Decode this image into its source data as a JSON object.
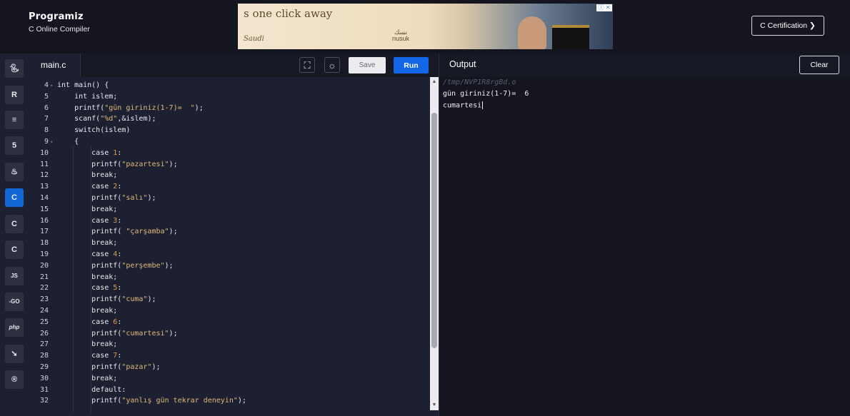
{
  "header": {
    "brand": "Programiz",
    "subtitle": "C Online Compiler",
    "certification_label": "C Certification ❯",
    "ad": {
      "headline": "s one click away",
      "signature": "Saudi",
      "brand_arabic": "نسك",
      "brand_latin": "nusuk",
      "info_badge": "ⓘ ✕"
    }
  },
  "sidebar": {
    "languages": [
      {
        "name": "python",
        "glyph": "🐍︎"
      },
      {
        "name": "r",
        "glyph": "R"
      },
      {
        "name": "sql",
        "glyph": "≡"
      },
      {
        "name": "html",
        "glyph": "5"
      },
      {
        "name": "java",
        "glyph": "♨"
      },
      {
        "name": "c",
        "glyph": "C"
      },
      {
        "name": "cpp",
        "glyph": "C"
      },
      {
        "name": "csharp",
        "glyph": "C"
      },
      {
        "name": "javascript",
        "glyph": "JS"
      },
      {
        "name": "go",
        "glyph": "-GO"
      },
      {
        "name": "php",
        "glyph": "php"
      },
      {
        "name": "swift",
        "glyph": "➘"
      },
      {
        "name": "rust",
        "glyph": "®"
      }
    ],
    "active": "c"
  },
  "editor": {
    "tab_label": "main.c",
    "fullscreen_icon": "fullscreen-icon",
    "theme_icon": "sun-icon",
    "save_label": "Save",
    "run_label": "Run",
    "lines": [
      {
        "n": "4",
        "text": "int main() {"
      },
      {
        "n": "5",
        "text": "    int islem;"
      },
      {
        "n": "6",
        "text": "    printf(\"gün giriniz(1-7)=  \");"
      },
      {
        "n": "7",
        "text": "    scanf(\"%d\",&islem);"
      },
      {
        "n": "8",
        "text": "    switch(islem)"
      },
      {
        "n": "9",
        "text": "    {"
      },
      {
        "n": "10",
        "text": "        case 1:"
      },
      {
        "n": "11",
        "text": "        printf(\"pazartesi\");"
      },
      {
        "n": "12",
        "text": "        break;"
      },
      {
        "n": "13",
        "text": "        case 2:"
      },
      {
        "n": "14",
        "text": "        printf(\"salı\");"
      },
      {
        "n": "15",
        "text": "        break;"
      },
      {
        "n": "16",
        "text": "        case 3:"
      },
      {
        "n": "17",
        "text": "        printf( \"çarşamba\");"
      },
      {
        "n": "18",
        "text": "        break;"
      },
      {
        "n": "19",
        "text": "        case 4:"
      },
      {
        "n": "20",
        "text": "        printf(\"perşembe\");"
      },
      {
        "n": "21",
        "text": "        break;"
      },
      {
        "n": "22",
        "text": "        case 5:"
      },
      {
        "n": "23",
        "text": "        printf(\"cuma\");"
      },
      {
        "n": "24",
        "text": "        break;"
      },
      {
        "n": "25",
        "text": "        case 6:"
      },
      {
        "n": "26",
        "text": "        printf(\"cumartesi\");"
      },
      {
        "n": "27",
        "text": "        break;"
      },
      {
        "n": "28",
        "text": "        case 7:"
      },
      {
        "n": "29",
        "text": "        printf(\"pazar\");"
      },
      {
        "n": "30",
        "text": "        break;"
      },
      {
        "n": "31",
        "text": "        default:"
      },
      {
        "n": "32",
        "text": "        printf(\"yanlış gün tekrar deneyin\");"
      }
    ],
    "fold_markers": [
      "4",
      "9"
    ]
  },
  "output": {
    "title": "Output",
    "clear_label": "Clear",
    "path": "/tmp/NVP1R8rgBd.o",
    "line1": "gün giriniz(1-7)=  6",
    "line2": "cumartesi"
  },
  "colors": {
    "accent": "#1366e6",
    "bg_editor": "#1d2030",
    "bg_output": "#14151f",
    "string": "#e0b87a",
    "number": "#e09a4a"
  }
}
